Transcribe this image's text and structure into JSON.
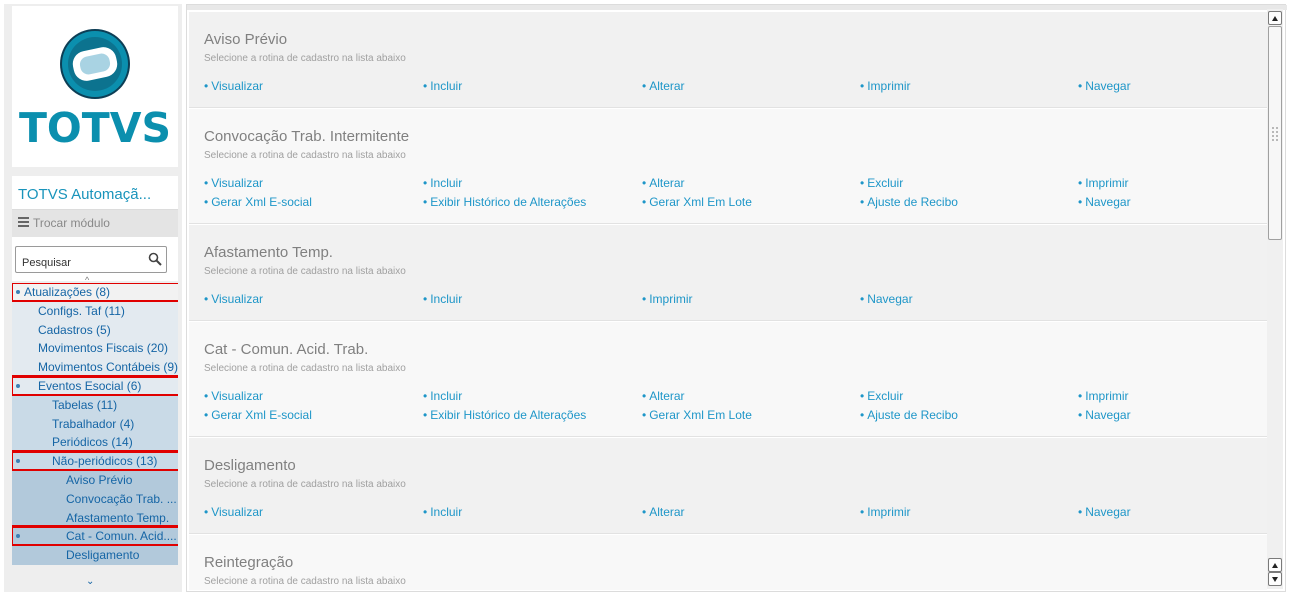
{
  "brand": {
    "logo_text": "TOTVS",
    "logo_color": "#0b8fae",
    "logo_dark": "#0d3e55"
  },
  "sidebar": {
    "module_title": "TOTVS Automaçã...",
    "switch_module_label": "Trocar módulo",
    "search_value": "Pesquisar",
    "tree": [
      {
        "label": "Atualizações (8)",
        "level": 0,
        "highlighted": true
      },
      {
        "label": "Configs. Taf (11)",
        "level": 1,
        "highlighted": false
      },
      {
        "label": "Cadastros (5)",
        "level": 1,
        "highlighted": false
      },
      {
        "label": "Movimentos Fiscais (20)",
        "level": 1,
        "highlighted": false
      },
      {
        "label": "Movimentos Contábeis (9)",
        "level": 1,
        "highlighted": false
      },
      {
        "label": "Eventos Esocial (6)",
        "level": 1,
        "highlighted": true
      },
      {
        "label": "Tabelas (11)",
        "level": 2,
        "highlighted": false
      },
      {
        "label": "Trabalhador (4)",
        "level": 2,
        "highlighted": false
      },
      {
        "label": "Periódicos (14)",
        "level": 2,
        "highlighted": false
      },
      {
        "label": "Não-periódicos (13)",
        "level": 2,
        "highlighted": true
      },
      {
        "label": "Aviso Prévio",
        "level": 3,
        "highlighted": false
      },
      {
        "label": "Convocação Trab. ...",
        "level": 3,
        "highlighted": false
      },
      {
        "label": "Afastamento Temp.",
        "level": 3,
        "highlighted": false
      },
      {
        "label": "Cat - Comun. Acid....",
        "level": 3,
        "highlighted": true
      },
      {
        "label": "Desligamento",
        "level": 3,
        "highlighted": false
      }
    ]
  },
  "main": {
    "sections": [
      {
        "title": "Aviso Prévio",
        "subtitle": "Selecione a rotina de cadastro na lista abaixo",
        "rows": [
          [
            "Visualizar",
            "Incluir",
            "Alterar",
            "Imprimir",
            "Navegar"
          ]
        ]
      },
      {
        "title": "Convocação Trab. Intermitente",
        "subtitle": "Selecione a rotina de cadastro na lista abaixo",
        "rows": [
          [
            "Visualizar",
            "Incluir",
            "Alterar",
            "Excluir",
            "Imprimir"
          ],
          [
            "Gerar Xml E-social",
            "Exibir Histórico de Alterações",
            "Gerar Xml Em Lote",
            "Ajuste de Recibo",
            "Navegar"
          ]
        ]
      },
      {
        "title": "Afastamento Temp.",
        "subtitle": "Selecione a rotina de cadastro na lista abaixo",
        "rows": [
          [
            "Visualizar",
            "Incluir",
            "Imprimir",
            "Navegar"
          ]
        ]
      },
      {
        "title": "Cat - Comun. Acid. Trab.",
        "subtitle": "Selecione a rotina de cadastro na lista abaixo",
        "rows": [
          [
            "Visualizar",
            "Incluir",
            "Alterar",
            "Excluir",
            "Imprimir"
          ],
          [
            "Gerar Xml E-social",
            "Exibir Histórico de Alterações",
            "Gerar Xml Em Lote",
            "Ajuste de Recibo",
            "Navegar"
          ]
        ]
      },
      {
        "title": "Desligamento",
        "subtitle": "Selecione a rotina de cadastro na lista abaixo",
        "rows": [
          [
            "Visualizar",
            "Incluir",
            "Alterar",
            "Imprimir",
            "Navegar"
          ]
        ]
      },
      {
        "title": "Reintegração",
        "subtitle": "Selecione a rotina de cadastro na lista abaixo",
        "rows": []
      }
    ]
  },
  "colors": {
    "accent": "#1e96c8",
    "tree_text": "#1565a5",
    "highlight_box": "#e00000"
  }
}
